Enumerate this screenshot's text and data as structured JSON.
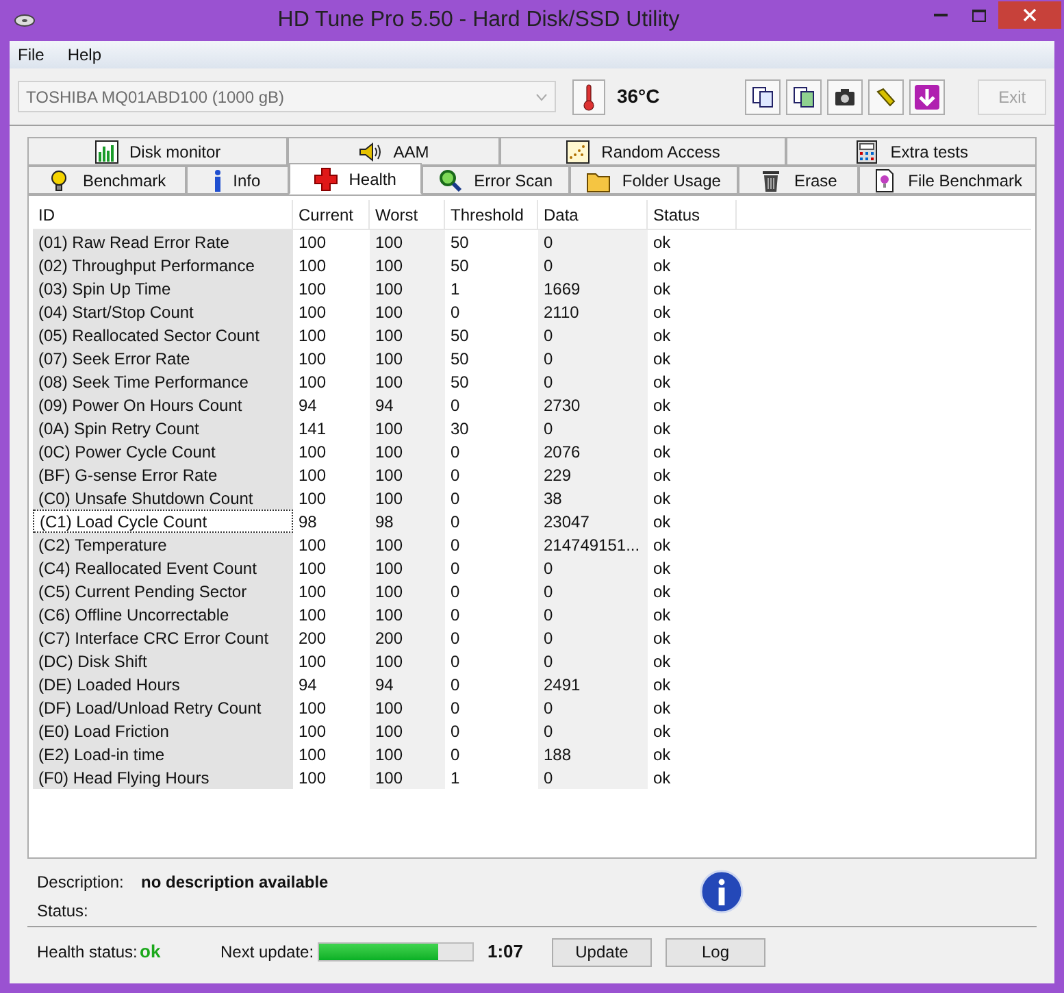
{
  "window": {
    "title": "HD Tune Pro 5.50 - Hard Disk/SSD Utility"
  },
  "menu": [
    "File",
    "Help"
  ],
  "toolbar": {
    "drive": "TOSHIBA MQ01ABD100 (1000 gB)",
    "temperature": "36°C",
    "exit": {
      "label": "Exit",
      "disabled": true
    }
  },
  "tabs_top": [
    {
      "label": "Disk monitor",
      "selected": false,
      "kind": "monitor"
    },
    {
      "label": "AAM",
      "selected": false,
      "kind": "speaker"
    },
    {
      "label": "Random Access",
      "selected": false,
      "kind": "scatter"
    },
    {
      "label": "Extra tests",
      "selected": false,
      "kind": "calculator"
    }
  ],
  "tabs_bottom": [
    {
      "label": "Benchmark",
      "selected": false,
      "kind": "bulb"
    },
    {
      "label": "Info",
      "selected": false,
      "kind": "info"
    },
    {
      "label": "Health",
      "selected": true,
      "kind": "cross"
    },
    {
      "label": "Error Scan",
      "selected": false,
      "kind": "magnifier"
    },
    {
      "label": "Folder Usage",
      "selected": false,
      "kind": "folder"
    },
    {
      "label": "Erase",
      "selected": false,
      "kind": "bin"
    },
    {
      "label": "File Benchmark",
      "selected": false,
      "kind": "file"
    }
  ],
  "table": {
    "columns": [
      "ID",
      "Current",
      "Worst",
      "Threshold",
      "Data",
      "Status"
    ],
    "rows": [
      {
        "cells": [
          "(01) Raw Read Error Rate",
          "100",
          "100",
          "50",
          "0",
          "ok"
        ],
        "selected": false
      },
      {
        "cells": [
          "(02) Throughput Performance",
          "100",
          "100",
          "50",
          "0",
          "ok"
        ],
        "selected": false
      },
      {
        "cells": [
          "(03) Spin Up Time",
          "100",
          "100",
          "1",
          "1669",
          "ok"
        ],
        "selected": false
      },
      {
        "cells": [
          "(04) Start/Stop Count",
          "100",
          "100",
          "0",
          "2110",
          "ok"
        ],
        "selected": false
      },
      {
        "cells": [
          "(05) Reallocated Sector Count",
          "100",
          "100",
          "50",
          "0",
          "ok"
        ],
        "selected": false
      },
      {
        "cells": [
          "(07) Seek Error Rate",
          "100",
          "100",
          "50",
          "0",
          "ok"
        ],
        "selected": false
      },
      {
        "cells": [
          "(08) Seek Time Performance",
          "100",
          "100",
          "50",
          "0",
          "ok"
        ],
        "selected": false
      },
      {
        "cells": [
          "(09) Power On Hours Count",
          "94",
          "94",
          "0",
          "2730",
          "ok"
        ],
        "selected": false
      },
      {
        "cells": [
          "(0A) Spin Retry Count",
          "141",
          "100",
          "30",
          "0",
          "ok"
        ],
        "selected": false
      },
      {
        "cells": [
          "(0C) Power Cycle Count",
          "100",
          "100",
          "0",
          "2076",
          "ok"
        ],
        "selected": false
      },
      {
        "cells": [
          "(BF) G-sense Error Rate",
          "100",
          "100",
          "0",
          "229",
          "ok"
        ],
        "selected": false
      },
      {
        "cells": [
          "(C0) Unsafe Shutdown Count",
          "100",
          "100",
          "0",
          "38",
          "ok"
        ],
        "selected": false
      },
      {
        "cells": [
          "(C1) Load Cycle Count",
          "98",
          "98",
          "0",
          "23047",
          "ok"
        ],
        "selected": true
      },
      {
        "cells": [
          "(C2) Temperature",
          "100",
          "100",
          "0",
          "214749151...",
          "ok"
        ],
        "selected": false
      },
      {
        "cells": [
          "(C4) Reallocated Event Count",
          "100",
          "100",
          "0",
          "0",
          "ok"
        ],
        "selected": false
      },
      {
        "cells": [
          "(C5) Current Pending Sector",
          "100",
          "100",
          "0",
          "0",
          "ok"
        ],
        "selected": false
      },
      {
        "cells": [
          "(C6) Offline Uncorrectable",
          "100",
          "100",
          "0",
          "0",
          "ok"
        ],
        "selected": false
      },
      {
        "cells": [
          "(C7) Interface CRC Error Count",
          "200",
          "200",
          "0",
          "0",
          "ok"
        ],
        "selected": false
      },
      {
        "cells": [
          "(DC) Disk Shift",
          "100",
          "100",
          "0",
          "0",
          "ok"
        ],
        "selected": false
      },
      {
        "cells": [
          "(DE) Loaded Hours",
          "94",
          "94",
          "0",
          "2491",
          "ok"
        ],
        "selected": false
      },
      {
        "cells": [
          "(DF) Load/Unload Retry Count",
          "100",
          "100",
          "0",
          "0",
          "ok"
        ],
        "selected": false
      },
      {
        "cells": [
          "(E0) Load Friction",
          "100",
          "100",
          "0",
          "0",
          "ok"
        ],
        "selected": false
      },
      {
        "cells": [
          "(E2) Load-in time",
          "100",
          "100",
          "0",
          "188",
          "ok"
        ],
        "selected": false
      },
      {
        "cells": [
          "(F0) Head Flying Hours",
          "100",
          "100",
          "1",
          "0",
          "ok"
        ],
        "selected": false
      }
    ]
  },
  "details": {
    "description_label": "Description:",
    "description": "no description available",
    "status_label": "Status:"
  },
  "footer": {
    "health_label": "Health status:",
    "health": "ok",
    "next_label": "Next update:",
    "level": 0.78,
    "time": "1:07",
    "buttons": [
      "Update",
      "Log"
    ]
  }
}
